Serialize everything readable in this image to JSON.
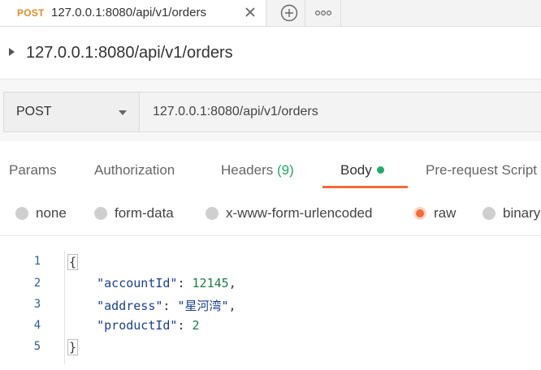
{
  "tab": {
    "method": "POST",
    "title": "127.0.0.1:8080/api/v1/orders",
    "close_icon": "close-icon",
    "add_icon": "plus-circle-icon",
    "more_icon": "ellipsis-icon"
  },
  "request": {
    "name": "127.0.0.1:8080/api/v1/orders",
    "method": "POST",
    "url": "127.0.0.1:8080/api/v1/orders"
  },
  "req_tabs": {
    "params": "Params",
    "authorization": "Authorization",
    "headers": "Headers",
    "headers_count": "(9)",
    "body": "Body",
    "prerequest": "Pre-request Script"
  },
  "body_types": {
    "none": "none",
    "form_data": "form-data",
    "urlencoded": "x-www-form-urlencoded",
    "raw": "raw",
    "binary": "binary",
    "selected": "raw"
  },
  "editor": {
    "line_numbers": [
      "1",
      "2",
      "3",
      "4",
      "5"
    ],
    "open_brace": "{",
    "close_brace": "}",
    "fields": [
      {
        "key": "\"accountId\"",
        "value": "12145",
        "sep": ",",
        "kind": "num"
      },
      {
        "key": "\"address\"",
        "value": "\"星河湾\"",
        "sep": ",",
        "kind": "str"
      },
      {
        "key": "\"productId\"",
        "value": "2",
        "sep": "",
        "kind": "num"
      }
    ]
  },
  "colors": {
    "post": "#e28d2d",
    "accent": "#f26b3a",
    "green": "#26a86b"
  }
}
